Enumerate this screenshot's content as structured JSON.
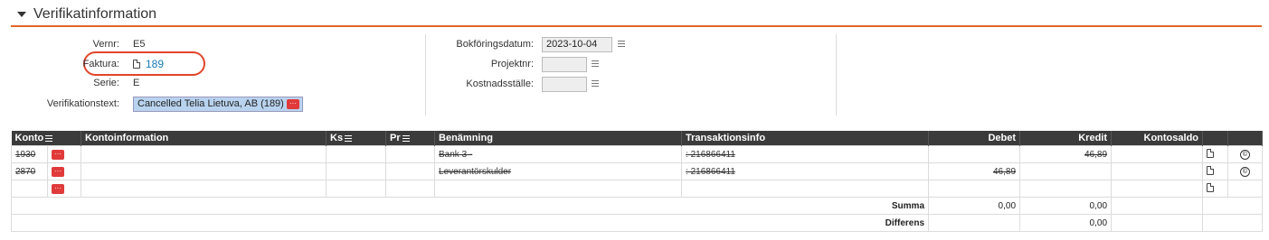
{
  "header": {
    "title": "Verifikatinformation"
  },
  "form_left": {
    "vernr_label": "Vernr:",
    "vernr_value": "E5",
    "faktura_label": "Faktura:",
    "faktura_value": "189",
    "serie_label": "Serie:",
    "serie_value": "E",
    "verifikationstext_label": "Verifikationstext:",
    "verifikationstext_value": "Cancelled Telia Lietuva, AB (189)",
    "dots": "···"
  },
  "form_right": {
    "bokforingsdatum_label": "Bokföringsdatum:",
    "bokforingsdatum_value": "2023-10-04",
    "projektnr_label": "Projektnr:",
    "projektnr_value": "",
    "kostnadsstalle_label": "Kostnadsställe:",
    "kostnadsstalle_value": ""
  },
  "table": {
    "columns": [
      "Konto",
      "Kontoinformation",
      "Ks",
      "Pr",
      "Benämning",
      "Transaktionsinfo",
      "Debet",
      "Kredit",
      "Kontosaldo"
    ],
    "rows": [
      {
        "konto": "1930",
        "benamning": "Bank 3 -",
        "transinfo": ": 216866411",
        "debet": "",
        "kredit": "46,89"
      },
      {
        "konto": "2870",
        "benamning": "Leverantörskulder",
        "transinfo": ": 216866411",
        "debet": "46,89",
        "kredit": ""
      },
      {
        "konto": "",
        "benamning": "",
        "transinfo": "",
        "debet": "",
        "kredit": ""
      }
    ],
    "summa_label": "Summa",
    "summa_debet": "0,00",
    "summa_kredit": "0,00",
    "differens_label": "Differens",
    "differens_kredit": "0,00",
    "copyright_glyph": "©"
  },
  "colors": {
    "accent": "#e2662a",
    "dots_button": "#e03a3a",
    "link": "#1a7ab5",
    "header_bg": "#3b3b3b"
  }
}
